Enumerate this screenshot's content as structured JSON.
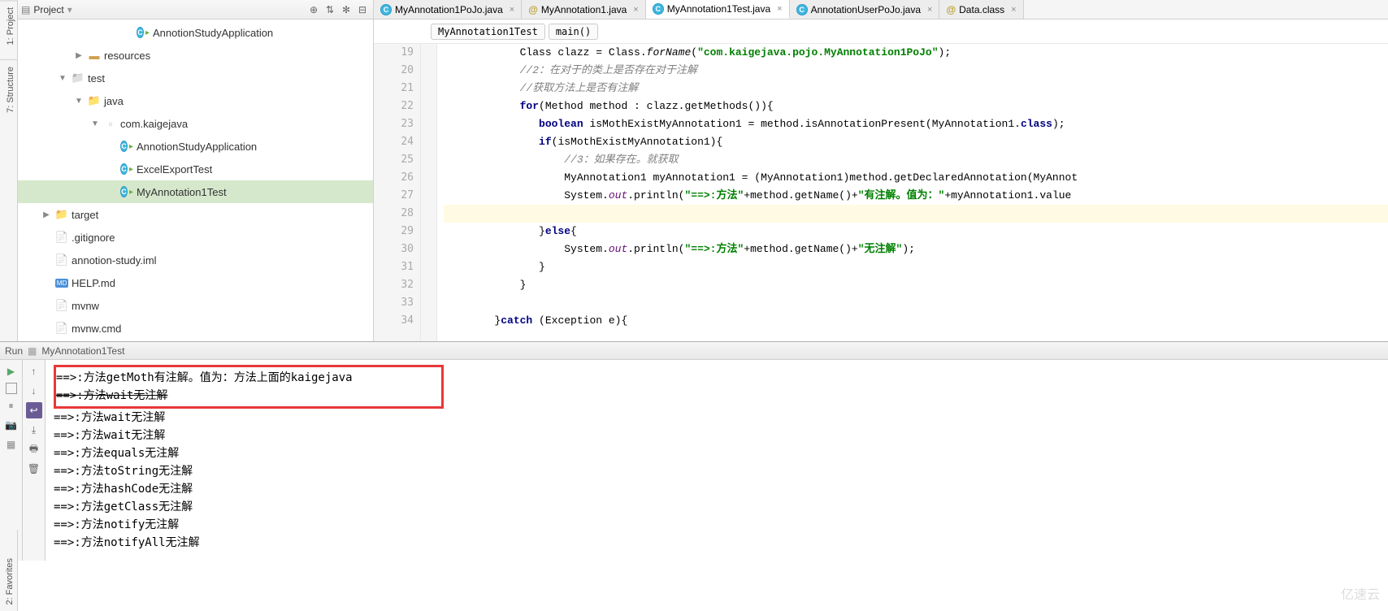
{
  "leftBar": {
    "project": "1: Project",
    "structure": "7: Structure"
  },
  "projectPanel": {
    "title": "Project"
  },
  "tree": [
    {
      "label": "AnnotionStudyApplication",
      "indent": 6,
      "arrow": "",
      "icon": "class"
    },
    {
      "label": "resources",
      "indent": 3,
      "arrow": "▶",
      "icon": "folder-res"
    },
    {
      "label": "test",
      "indent": 2,
      "arrow": "▼",
      "icon": "folder"
    },
    {
      "label": "java",
      "indent": 3,
      "arrow": "▼",
      "icon": "folder-test"
    },
    {
      "label": "com.kaigejava",
      "indent": 4,
      "arrow": "▼",
      "icon": "package"
    },
    {
      "label": "AnnotionStudyApplication",
      "indent": 5,
      "arrow": "",
      "icon": "class"
    },
    {
      "label": "ExcelExportTest",
      "indent": 5,
      "arrow": "",
      "icon": "class"
    },
    {
      "label": "MyAnnotation1Test",
      "indent": 5,
      "arrow": "",
      "icon": "class",
      "selected": true
    },
    {
      "label": "target",
      "indent": 1,
      "arrow": "▶",
      "icon": "folder-target"
    },
    {
      "label": ".gitignore",
      "indent": 1,
      "arrow": "",
      "icon": "file"
    },
    {
      "label": "annotion-study.iml",
      "indent": 1,
      "arrow": "",
      "icon": "file"
    },
    {
      "label": "HELP.md",
      "indent": 1,
      "arrow": "",
      "icon": "md"
    },
    {
      "label": "mvnw",
      "indent": 1,
      "arrow": "",
      "icon": "file"
    },
    {
      "label": "mvnw.cmd",
      "indent": 1,
      "arrow": "",
      "icon": "file"
    }
  ],
  "tabs": [
    {
      "label": "MyAnnotation1PoJo.java",
      "icon": "blue",
      "active": false
    },
    {
      "label": "MyAnnotation1.java",
      "icon": "at",
      "active": false
    },
    {
      "label": "MyAnnotation1Test.java",
      "icon": "blue",
      "active": true
    },
    {
      "label": "AnnotationUserPoJo.java",
      "icon": "blue",
      "active": false
    },
    {
      "label": "Data.class",
      "icon": "at",
      "active": false
    }
  ],
  "breadcrumb": {
    "class": "MyAnnotation1Test",
    "method": "main()"
  },
  "code": {
    "startLine": 19,
    "lines": [
      "            Class clazz = Class.<i>forName</i>(<s>\"com.kaigejava.pojo.MyAnnotation1PoJo\"</s>);",
      "            <c>//2：在对于的类上是否存在对于注解</c>",
      "            <c>//获取方法上是否有注解</c>",
      "            <k>for</k>(Method method : clazz.getMethods()){",
      "               <k>boolean</k> isMothExistMyAnnotation1 = method.isAnnotationPresent(MyAnnotation1.<k>class</k>);",
      "               <k>if</k>(isMothExistMyAnnotation1){",
      "                   <c>//3：如果存在。就获取</c>",
      "                   MyAnnotation1 myAnnotation1 = (MyAnnotation1)method.getDeclaredAnnotation(MyAnnot",
      "                   System.<fn>out</fn>.println(<s>\"==>:方法\"</s>+method.getName()+<s>\"有注解。值为：\"</s>+myAnnotation1.value",
      "",
      "               }<k>else</k>{",
      "                   System.<fn>out</fn>.println(<s>\"==>:方法\"</s>+method.getName()+<s>\"无注解\"</s>);",
      "               }",
      "            }",
      "",
      "        }<k>catch</k> (Exception e){"
    ]
  },
  "run": {
    "label": "Run",
    "config": "MyAnnotation1Test",
    "output": [
      {
        "text": "==>:方法getMoth有注解。值为：方法上面的kaigejava",
        "boxed": true
      },
      {
        "text": "==>:方法wait无注解",
        "strike": true,
        "inbox": true
      },
      {
        "text": "==>:方法wait无注解"
      },
      {
        "text": "==>:方法wait无注解"
      },
      {
        "text": "==>:方法equals无注解"
      },
      {
        "text": "==>:方法toString无注解"
      },
      {
        "text": "==>:方法hashCode无注解"
      },
      {
        "text": "==>:方法getClass无注解"
      },
      {
        "text": "==>:方法notify无注解"
      },
      {
        "text": "==>:方法notifyAll无注解"
      }
    ]
  },
  "favorites": "2: Favorites",
  "watermark": "亿速云"
}
